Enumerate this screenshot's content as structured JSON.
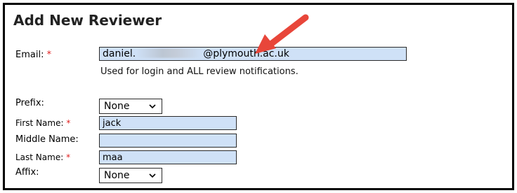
{
  "form": {
    "title": "Add New Reviewer",
    "required_marker": "*",
    "email": {
      "label": "Email:",
      "value_prefix": "daniel.",
      "value_suffix": "@plymouth.ac.uk",
      "hint": "Used for login and ALL review notifications."
    },
    "prefix": {
      "label": "Prefix:",
      "selected": "None"
    },
    "first_name": {
      "label": "First Name:",
      "value": "jack"
    },
    "middle_name": {
      "label": "Middle Name:",
      "value": ""
    },
    "last_name": {
      "label": "Last Name:",
      "value": "maa"
    },
    "affix": {
      "label": "Affix:",
      "selected": "None"
    }
  },
  "icons": {
    "dropdown": "chevron-down-icon",
    "annotation": "red-arrow-icon"
  },
  "colors": {
    "field_bg": "#cfe1f7",
    "required": "#e02020",
    "arrow": "#e8463a"
  }
}
